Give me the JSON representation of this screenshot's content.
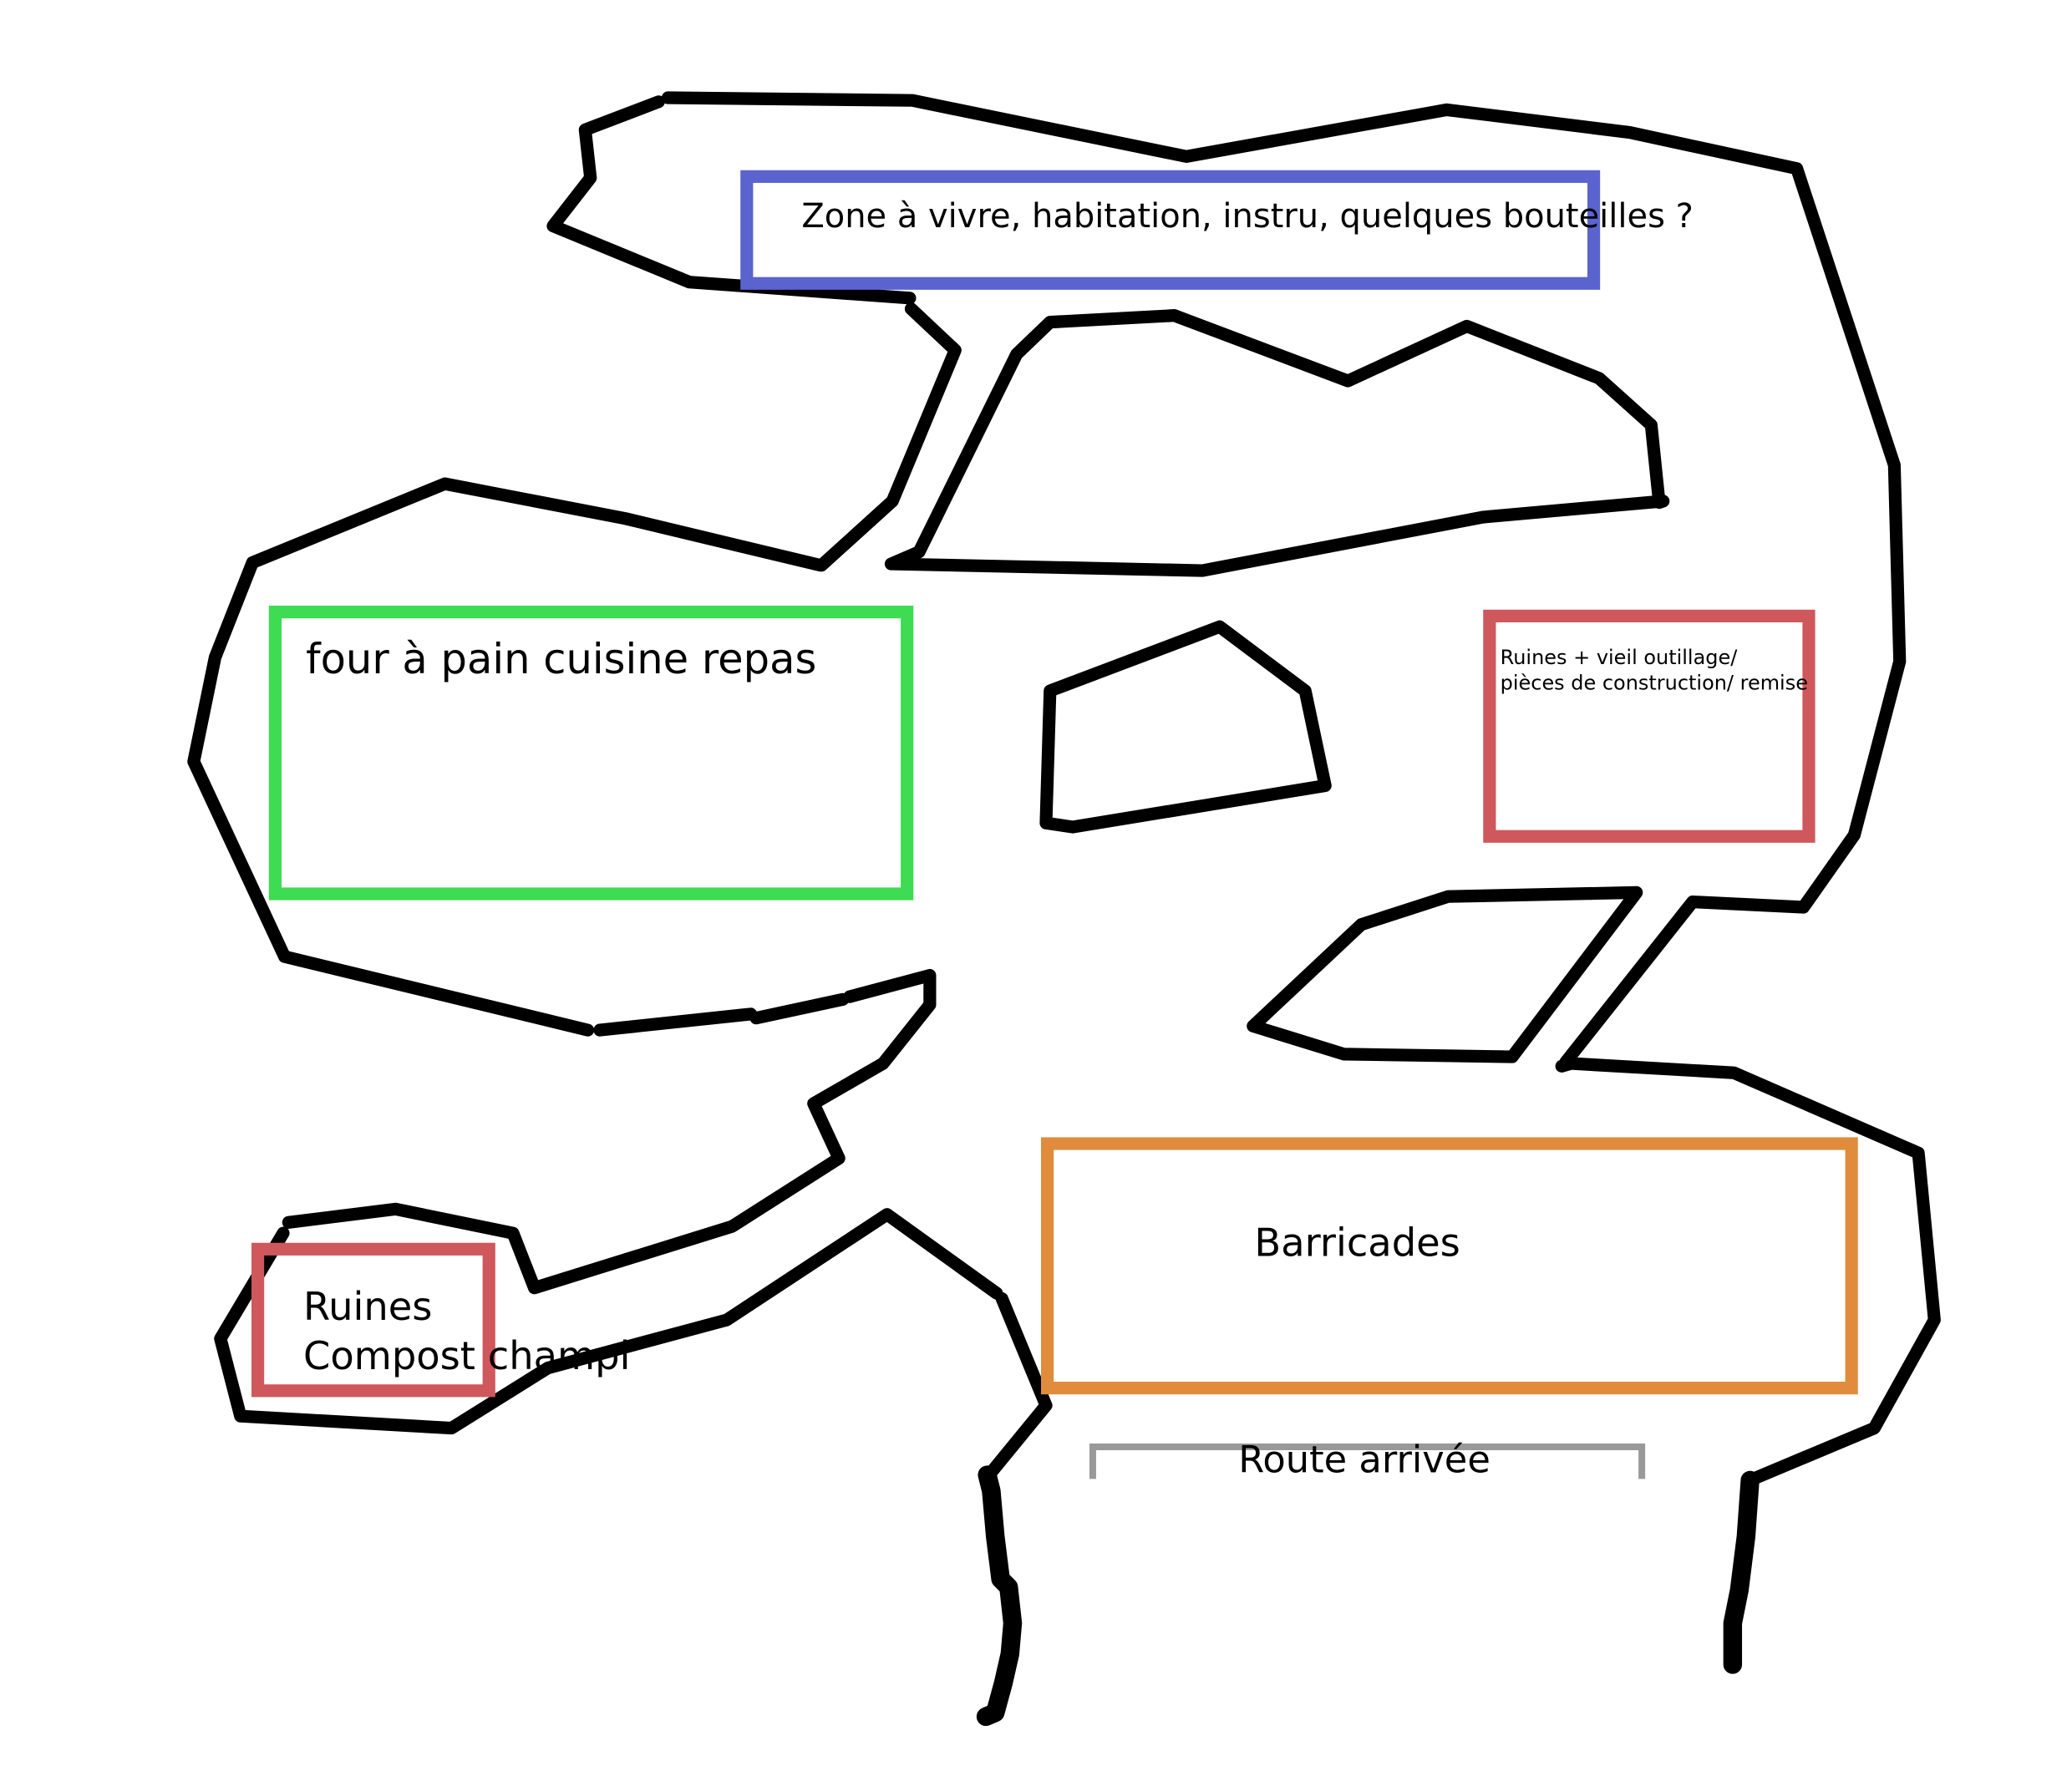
{
  "zones": {
    "living": {
      "label": "Zone à vivre, habitation, instru, quelques bouteilles ?",
      "color": "#5b63cf"
    },
    "kitchen": {
      "label": "four à pain cuisine repas",
      "color": "#3ddc52"
    },
    "ruins_tools": {
      "line1": "Ruines + vieil outillage/",
      "line2": "pièces de construction/ remise",
      "color": "#cf585c"
    },
    "ruins_compost": {
      "line1": "Ruines",
      "line2": "Compost champi",
      "color": "#cf585c"
    },
    "barricades": {
      "label": "Barricades",
      "color": "#e08c3c"
    },
    "road": {
      "label": "Route arrivée",
      "color": "#999999"
    }
  }
}
